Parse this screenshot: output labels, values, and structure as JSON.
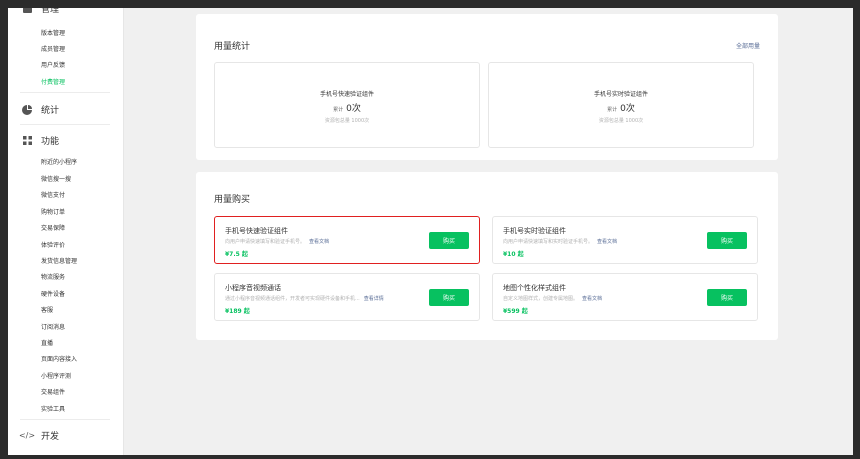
{
  "sidebar": {
    "sections": [
      {
        "icon": "grid-icon",
        "title": "管理",
        "items": [
          "版本管理",
          "成员管理",
          "用户反馈",
          "付费管理"
        ],
        "active": "付费管理"
      },
      {
        "icon": "pie-chart-icon",
        "title": "统计",
        "items": []
      },
      {
        "icon": "apps-icon",
        "title": "功能",
        "items": [
          "附近的小程序",
          "微信搜一搜",
          "微信支付",
          "购物订单",
          "交易保障",
          "体验评价",
          "发货信息管理",
          "物流服务",
          "硬件设备",
          "客服",
          "订阅消息",
          "直播",
          "页面内容接入",
          "小程序评测",
          "交易组件",
          "实验工具"
        ]
      },
      {
        "icon": "code-icon",
        "title": "开发",
        "items": []
      }
    ]
  },
  "usage": {
    "title": "用量统计",
    "link_all": "全部用量",
    "cards": [
      {
        "title": "手机号快速验证组件",
        "count_label": "累计",
        "count": "0次",
        "sub": "资源包总量 1000次"
      },
      {
        "title": "手机号实时验证组件",
        "count_label": "累计",
        "count": "0次",
        "sub": "资源包总量 1000次"
      }
    ]
  },
  "purchase": {
    "title": "用量购买",
    "items": [
      {
        "name": "手机号快速验证组件",
        "desc": "向用户申请快速填写和验证手机号。",
        "doc": "查看文档",
        "price": "¥7.5 起",
        "btn": "购买",
        "highlight": true
      },
      {
        "name": "手机号实时验证组件",
        "desc": "向用户申请快速填写和实时验证手机号。",
        "doc": "查看文档",
        "price": "¥10 起",
        "btn": "购买",
        "highlight": false
      },
      {
        "name": "小程序音视频通话",
        "desc": "通过小程序音视频通话组件，开发者可实现硬件设备和手机...",
        "doc": "查看详情",
        "price": "¥189 起",
        "btn": "购买",
        "highlight": false
      },
      {
        "name": "地图个性化样式组件",
        "desc": "自定义地图样式，创建专属地图。",
        "doc": "查看文档",
        "price": "¥599 起",
        "btn": "购买",
        "highlight": false
      }
    ]
  }
}
